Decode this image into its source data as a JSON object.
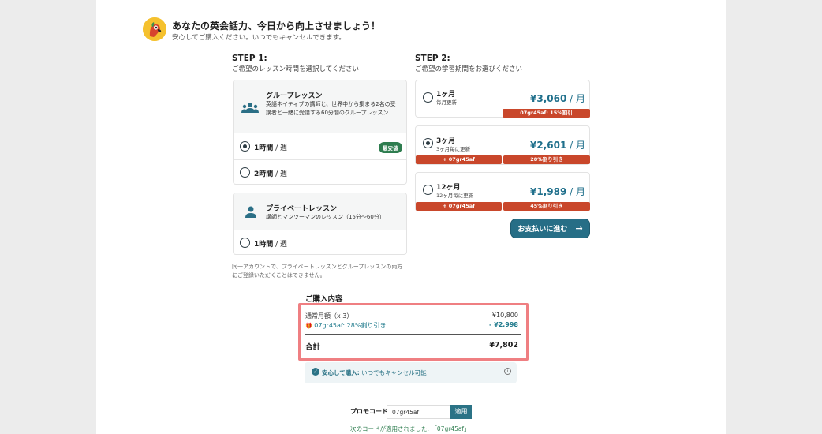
{
  "header": {
    "title": "あなたの英会話力、今日から向上させましょう！",
    "subtitle": "安心してご購入ください。いつでもキャンセルできます。"
  },
  "step1": {
    "title": "STEP 1:",
    "subtitle": "ご希望のレッスン時間を選択してください",
    "group": {
      "name": "グループレッスン",
      "desc": "英語ネイティブの講師と、世界中から集まる2名の受講者と一緒に受講する60分間のグループレッスン",
      "options": [
        {
          "hours": "1時間",
          "per": " / 週",
          "badge": "最安値",
          "selected": true
        },
        {
          "hours": "2時間",
          "per": " / 週",
          "selected": false
        }
      ]
    },
    "private": {
      "name": "プライベートレッスン",
      "desc": "講師とマンツーマンのレッスン（15分〜60分）",
      "options": [
        {
          "hours": "1時間",
          "per": " / 週",
          "selected": false
        }
      ]
    },
    "note": "同一アカウントで、プライベートレッスンとグループレッスンの両方にご登録いただくことはできません。"
  },
  "step2": {
    "title": "STEP 2:",
    "subtitle": "ご希望の学習期間をお選びください",
    "plans": [
      {
        "name": "1ヶ月",
        "sub": "毎月更新",
        "price": "¥3,060",
        "unit": " / 月",
        "tags": [
          "07gr45af: 15%割引"
        ],
        "selected": false
      },
      {
        "name": "3ヶ月",
        "sub": "3ヶ月毎に更新",
        "price": "¥2,601",
        "unit": " / 月",
        "tags": [
          "+ 07gr45af",
          "28%割り引き"
        ],
        "selected": true
      },
      {
        "name": "12ヶ月",
        "sub": "12ヶ月毎に更新",
        "price": "¥1,989",
        "unit": " / 月",
        "tags": [
          "+ 07gr45af",
          "45%割り引き"
        ],
        "selected": false
      }
    ],
    "pay_button": "お支払いに進む"
  },
  "summary": {
    "title": "ご購入内容",
    "regular_label": "通常月額（x 3）",
    "regular_value": "¥10,800",
    "discount_label": "07gr45af: 28%割り引き",
    "discount_value": "- ¥2,998",
    "total_label": "合計",
    "total_value": "¥7,802"
  },
  "safe": {
    "bold": "安心して購入:",
    "text": " いつでもキャンセル可能"
  },
  "promo": {
    "label": "プロモコード",
    "value": "07gr45af",
    "button": "適用",
    "applied": "次のコードが適用されました: 「07gr45af」"
  },
  "colors": {
    "teal": "#266e86",
    "red_tag": "#c9472b",
    "green_badge": "#2e7d4f",
    "highlight": "#ef7f82"
  }
}
